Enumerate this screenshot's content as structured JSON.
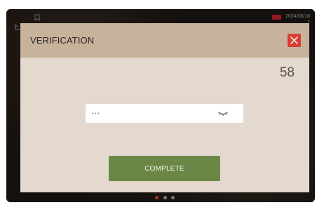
{
  "status": {
    "date": "2024/06/18",
    "time_fragment": "7"
  },
  "dialog": {
    "title": "VERIFICATION",
    "timer": "58",
    "password_value": "•••",
    "complete_label": "COMPLETE"
  },
  "icons": {
    "close": "close-icon",
    "visibility": "eye-closed-icon",
    "background_left": "bookmark-icon",
    "left_edge": "corner-icon"
  },
  "colors": {
    "header": "#c7b29c",
    "dialog_bg": "#e4d9cf",
    "close_bg": "#d93d32",
    "button_bg": "#6b8745",
    "active_dot": "#b52e26"
  },
  "pagination": {
    "active_index": 0,
    "count": 3
  }
}
